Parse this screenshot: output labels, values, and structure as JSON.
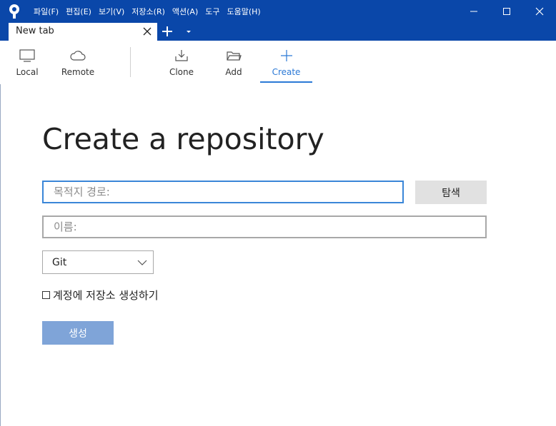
{
  "menu": [
    "파일(F)",
    "편집(E)",
    "보기(V)",
    "저장소(R)",
    "액션(A)",
    "도구",
    "도움말(H)"
  ],
  "tabs": [
    {
      "label": "New tab"
    }
  ],
  "toolbar": {
    "items": [
      {
        "label": "Local",
        "icon": "monitor-icon"
      },
      {
        "label": "Remote",
        "icon": "cloud-icon"
      },
      {
        "label": "Clone",
        "icon": "download-icon"
      },
      {
        "label": "Add",
        "icon": "folder-icon"
      },
      {
        "label": "Create",
        "icon": "plus-icon"
      }
    ],
    "active": "Create"
  },
  "page": {
    "title": "Create a repository",
    "destination": {
      "placeholder": "목적지 경로:",
      "value": ""
    },
    "browse_label": "탐색",
    "name": {
      "placeholder": "이름:",
      "value": ""
    },
    "repo_type": {
      "selected": "Git"
    },
    "create_on_account": {
      "label": "계정에 저장소 생성하기",
      "checked": false
    },
    "create_label": "생성"
  },
  "colors": {
    "titlebar": "#0a47a9",
    "accent": "#2b79d6",
    "create_button": "#7fa4d8"
  }
}
